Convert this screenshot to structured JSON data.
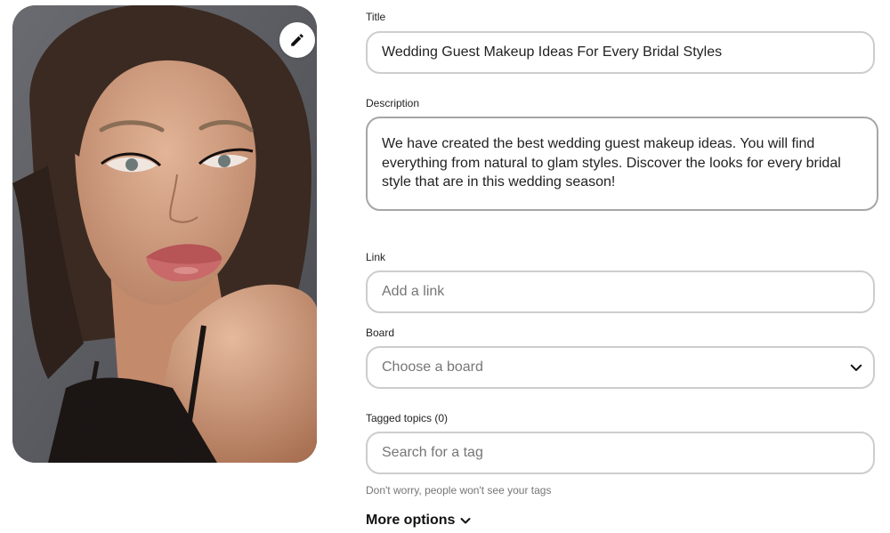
{
  "image": {
    "edit_icon": "pencil-icon",
    "subject": "portrait-photo"
  },
  "form": {
    "title": {
      "label": "Title",
      "value": "Wedding Guest Makeup Ideas For Every Bridal Styles"
    },
    "description": {
      "label": "Description",
      "value": "We have created the best wedding guest makeup ideas. You will find everything from natural to glam styles. Discover the looks for every bridal style that are in this wedding season!"
    },
    "link": {
      "label": "Link",
      "placeholder": "Add a link"
    },
    "board": {
      "label": "Board",
      "placeholder": "Choose a board",
      "icon": "chevron-down-icon"
    },
    "tags": {
      "label": "Tagged topics (0)",
      "placeholder": "Search for a tag",
      "helper": "Don't worry, people won't see your tags"
    },
    "more_options": {
      "label": "More options",
      "icon": "chevron-down-icon"
    }
  },
  "colors": {
    "field_border": "#cdcdcd",
    "focused_border": "#a6a6a6",
    "placeholder": "#767676"
  }
}
